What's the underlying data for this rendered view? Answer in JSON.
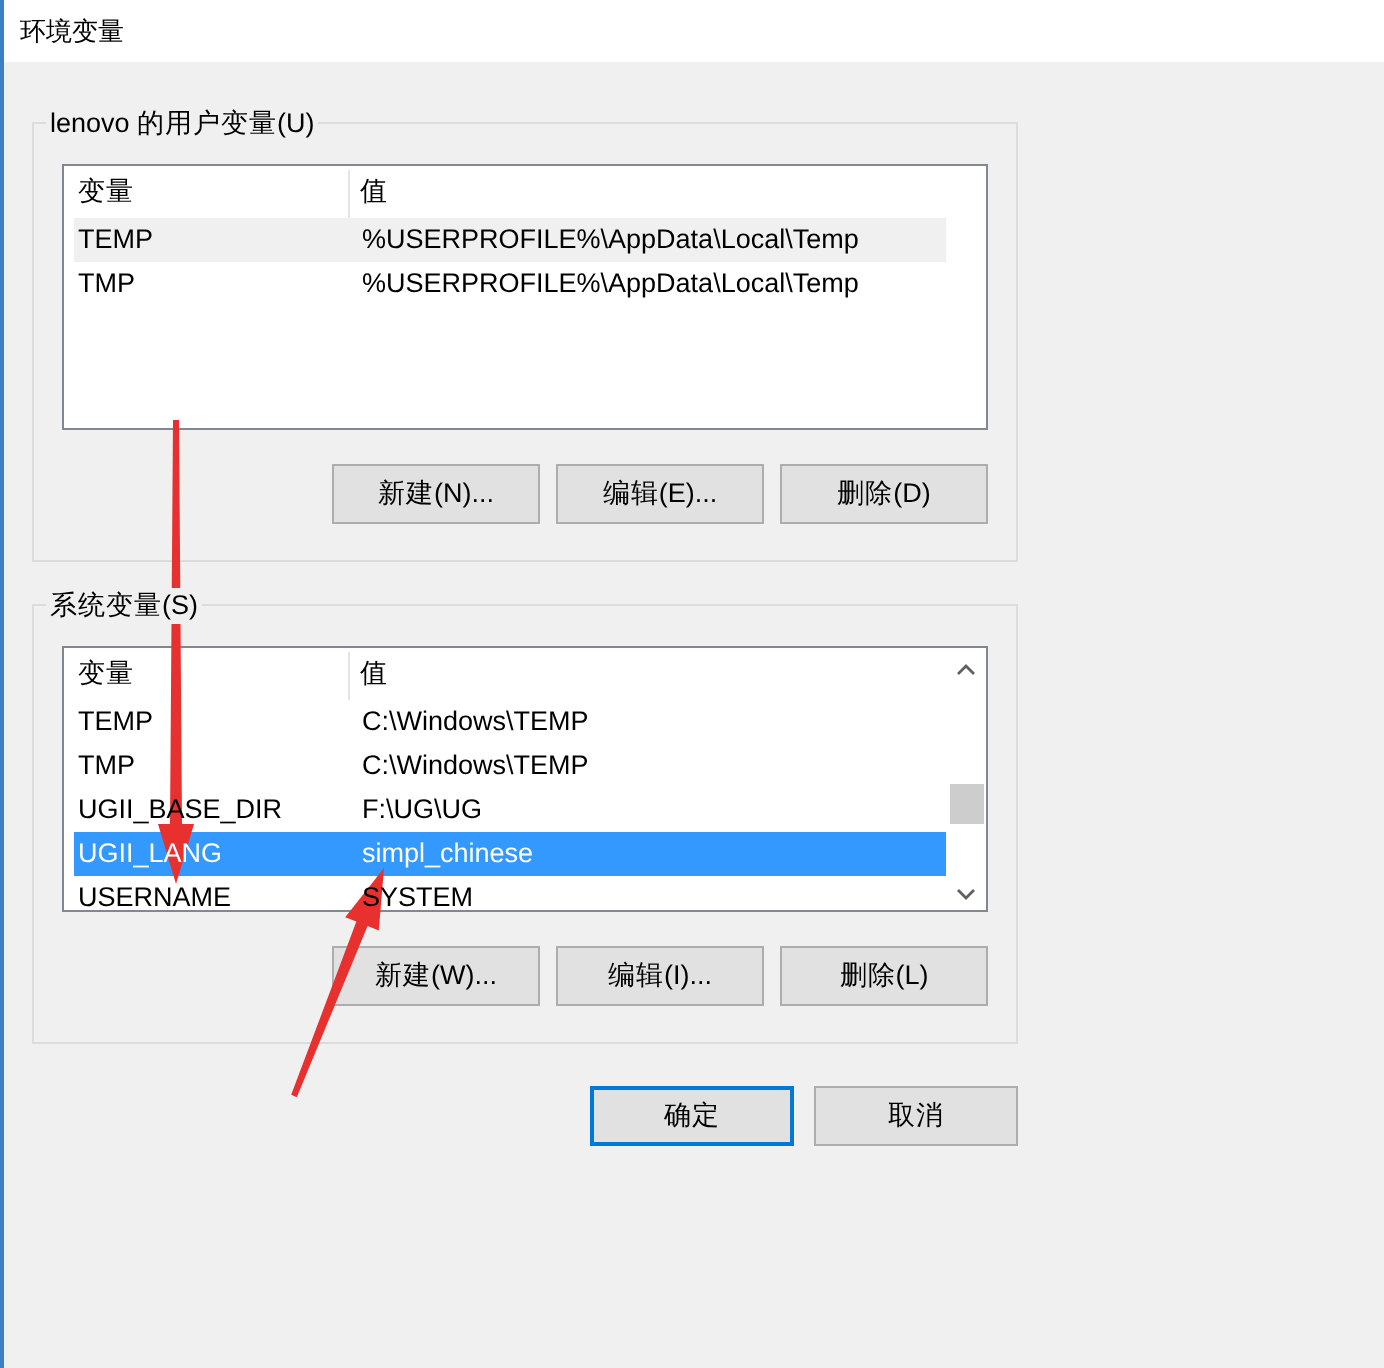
{
  "window": {
    "title": "环境变量"
  },
  "user_variables": {
    "label": "lenovo 的用户变量(U)",
    "focused": false,
    "columns": [
      "变量",
      "值"
    ],
    "rows": [
      {
        "name": "TEMP",
        "value": "%USERPROFILE%\\AppData\\Local\\Temp",
        "selected": true
      },
      {
        "name": "TMP",
        "value": "%USERPROFILE%\\AppData\\Local\\Temp",
        "selected": false
      }
    ],
    "buttons": [
      "新建(N)...",
      "编辑(E)...",
      "删除(D)"
    ]
  },
  "system_variables": {
    "label": "系统变量(S)",
    "focused": true,
    "scrollbar": true,
    "columns": [
      "变量",
      "值"
    ],
    "rows": [
      {
        "name": "TEMP",
        "value": "C:\\Windows\\TEMP",
        "selected": false
      },
      {
        "name": "TMP",
        "value": "C:\\Windows\\TEMP",
        "selected": false
      },
      {
        "name": "UGII_BASE_DIR",
        "value": "F:\\UG\\UG",
        "selected": false
      },
      {
        "name": "UGII_LANG",
        "value": "simpl_chinese",
        "selected": true
      },
      {
        "name": "USERNAME",
        "value": "SYSTEM",
        "selected": false
      }
    ],
    "buttons": [
      "新建(W)...",
      "编辑(I)...",
      "删除(L)"
    ]
  },
  "dialog_buttons": [
    {
      "label": "确定",
      "default": true
    },
    {
      "label": "取消",
      "default": false
    }
  ],
  "annotations": [
    {
      "kind": "down-arrow"
    },
    {
      "kind": "up-arrow"
    }
  ]
}
